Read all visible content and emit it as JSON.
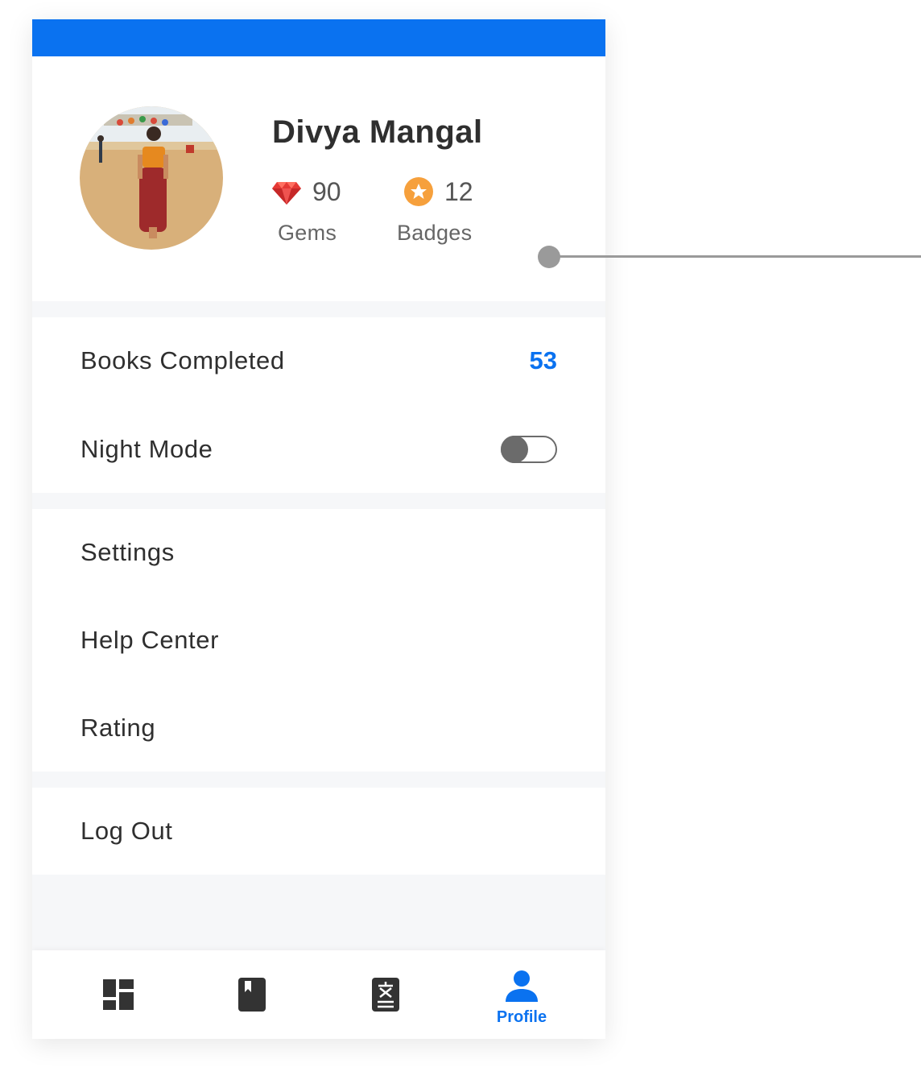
{
  "profile": {
    "name": "Divya Mangal",
    "gems": {
      "value": "90",
      "label": "Gems",
      "icon": "gem-icon"
    },
    "badges": {
      "value": "12",
      "label": "Badges",
      "icon": "badge-star-icon"
    }
  },
  "stats_section": {
    "books_completed": {
      "label": "Books Completed",
      "value": "53"
    },
    "night_mode": {
      "label": "Night Mode",
      "enabled": false
    }
  },
  "menu": {
    "settings": "Settings",
    "help_center": "Help Center",
    "rating": "Rating"
  },
  "logout": {
    "label": "Log Out"
  },
  "tab_bar": {
    "tabs": [
      {
        "icon": "dashboard-icon",
        "label": "",
        "active": false
      },
      {
        "icon": "bookmark-book-icon",
        "label": "",
        "active": false
      },
      {
        "icon": "translate-icon",
        "label": "",
        "active": false
      },
      {
        "icon": "person-icon",
        "label": "Profile",
        "active": true
      }
    ]
  },
  "colors": {
    "accent": "#0a72f0",
    "text_primary": "#2f2f2f",
    "text_secondary": "#666666",
    "gem_red": "#e53935",
    "badge_orange": "#f6a03c",
    "divider_bg": "#f6f7f9"
  }
}
